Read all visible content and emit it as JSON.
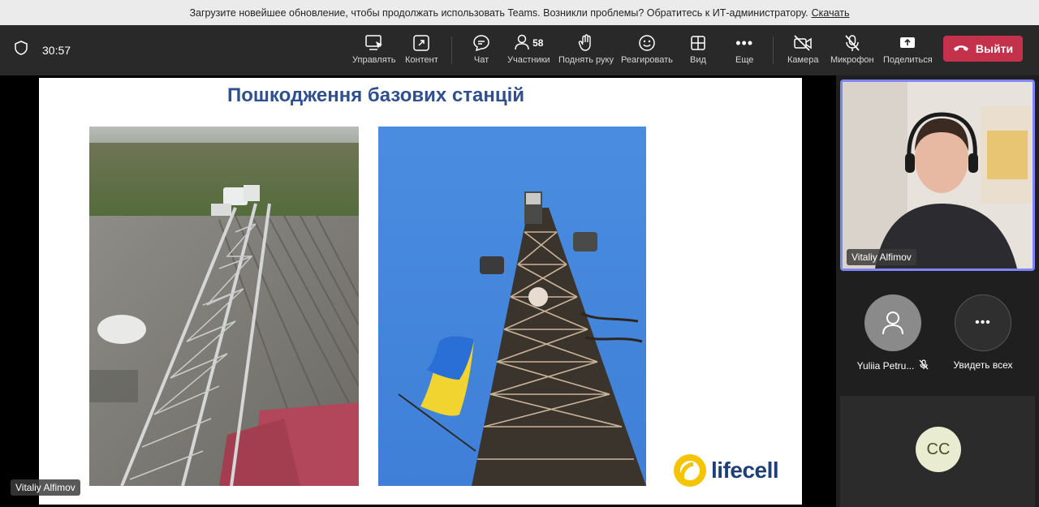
{
  "banner": {
    "message": "Загрузите новейшее обновление, чтобы продолжать использовать Teams. Возникли проблемы? Обратитесь к ИТ-администратору.",
    "link": "Скачать"
  },
  "toolbar": {
    "timer": "30:57",
    "buttons": {
      "manage": "Управлять",
      "content": "Контент",
      "chat": "Чат",
      "participants": "Участники",
      "participants_count": "58",
      "raise_hand": "Поднять руку",
      "react": "Реагировать",
      "view": "Вид",
      "more": "Еще",
      "camera": "Камера",
      "mic": "Микрофон",
      "share": "Поделиться"
    },
    "leave_label": "Выйти"
  },
  "slide": {
    "title": "Пошкодження базових станцій",
    "brand": "lifecell"
  },
  "stage": {
    "presenter_name": "Vitaliy Alfimov"
  },
  "sidebar": {
    "video_name": "Vitaliy Alfimov",
    "participant1_name": "Yuliia Petru...",
    "see_all_label": "Увидеть всех",
    "cc_initials": "CC"
  },
  "colors": {
    "leave": "#c4314b",
    "active_border": "#7f85f5",
    "slide_title": "#2f4f8f",
    "lifecell_yellow": "#f5c400"
  }
}
